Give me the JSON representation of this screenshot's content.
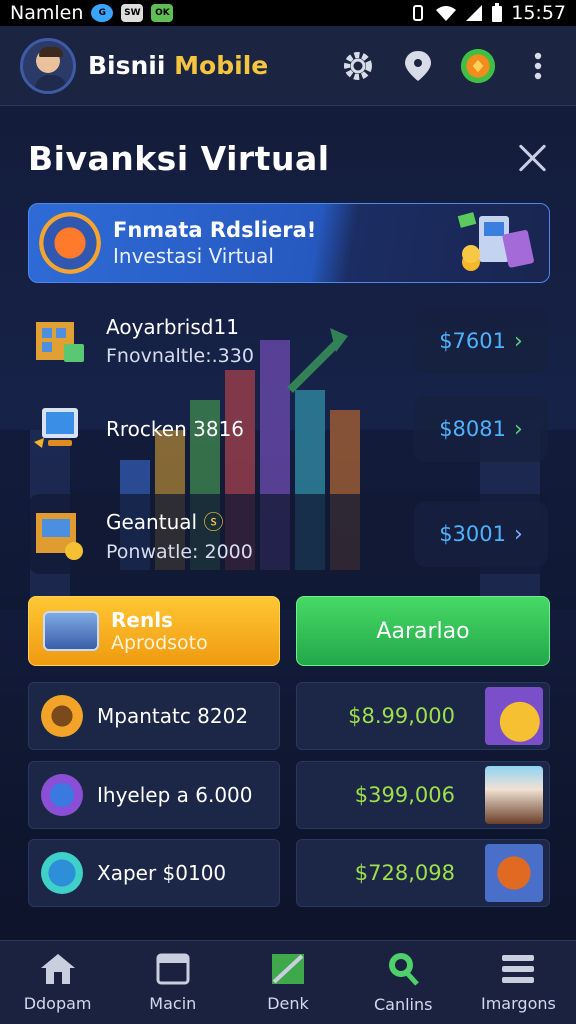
{
  "status_bar": {
    "carrier": "Namlen",
    "time": "15:57",
    "chip1": "G",
    "chip2": "SW",
    "chip3": "OK"
  },
  "app_bar": {
    "title": "Bisnii",
    "title_accent": "Mobile"
  },
  "page": {
    "title": "Bivanksi Virtual"
  },
  "banner": {
    "title": "Fnmata Rdsliera!",
    "subtitle": "Investasi Virtual"
  },
  "investments": [
    {
      "name": "Aoyarbrisd11",
      "sub": "Fnovnaltle:.330",
      "price": "$7601"
    },
    {
      "name": "Rrocken 3816",
      "sub": "",
      "price": "$8081"
    },
    {
      "name": "Geantual",
      "sub": "Ponwatle: 2000",
      "price": "$3001"
    }
  ],
  "actions": {
    "rent_title": "Renls",
    "rent_sub": "Aprodsoto",
    "green_label": "Aararlao"
  },
  "list": [
    {
      "label": "Mpantatc 8202",
      "amount": "$8.99,000"
    },
    {
      "label": "Ihyelep a 6.000",
      "amount": "$399,006"
    },
    {
      "label": "Xaper $0100",
      "amount": "$728,098"
    }
  ],
  "nav": [
    {
      "label": "Ddopam",
      "icon": "home-icon"
    },
    {
      "label": "Macin",
      "icon": "window-icon"
    },
    {
      "label": "Denk",
      "icon": "chart-icon"
    },
    {
      "label": "Canlins",
      "icon": "search-icon"
    },
    {
      "label": "Imargons",
      "icon": "menu-icon"
    }
  ],
  "colors": {
    "accent": "#f5c540",
    "price_blue": "#4fb2ff",
    "amount_green": "#9de04b",
    "btn_green": "#2bbf55",
    "btn_orange": "#f5a623"
  }
}
